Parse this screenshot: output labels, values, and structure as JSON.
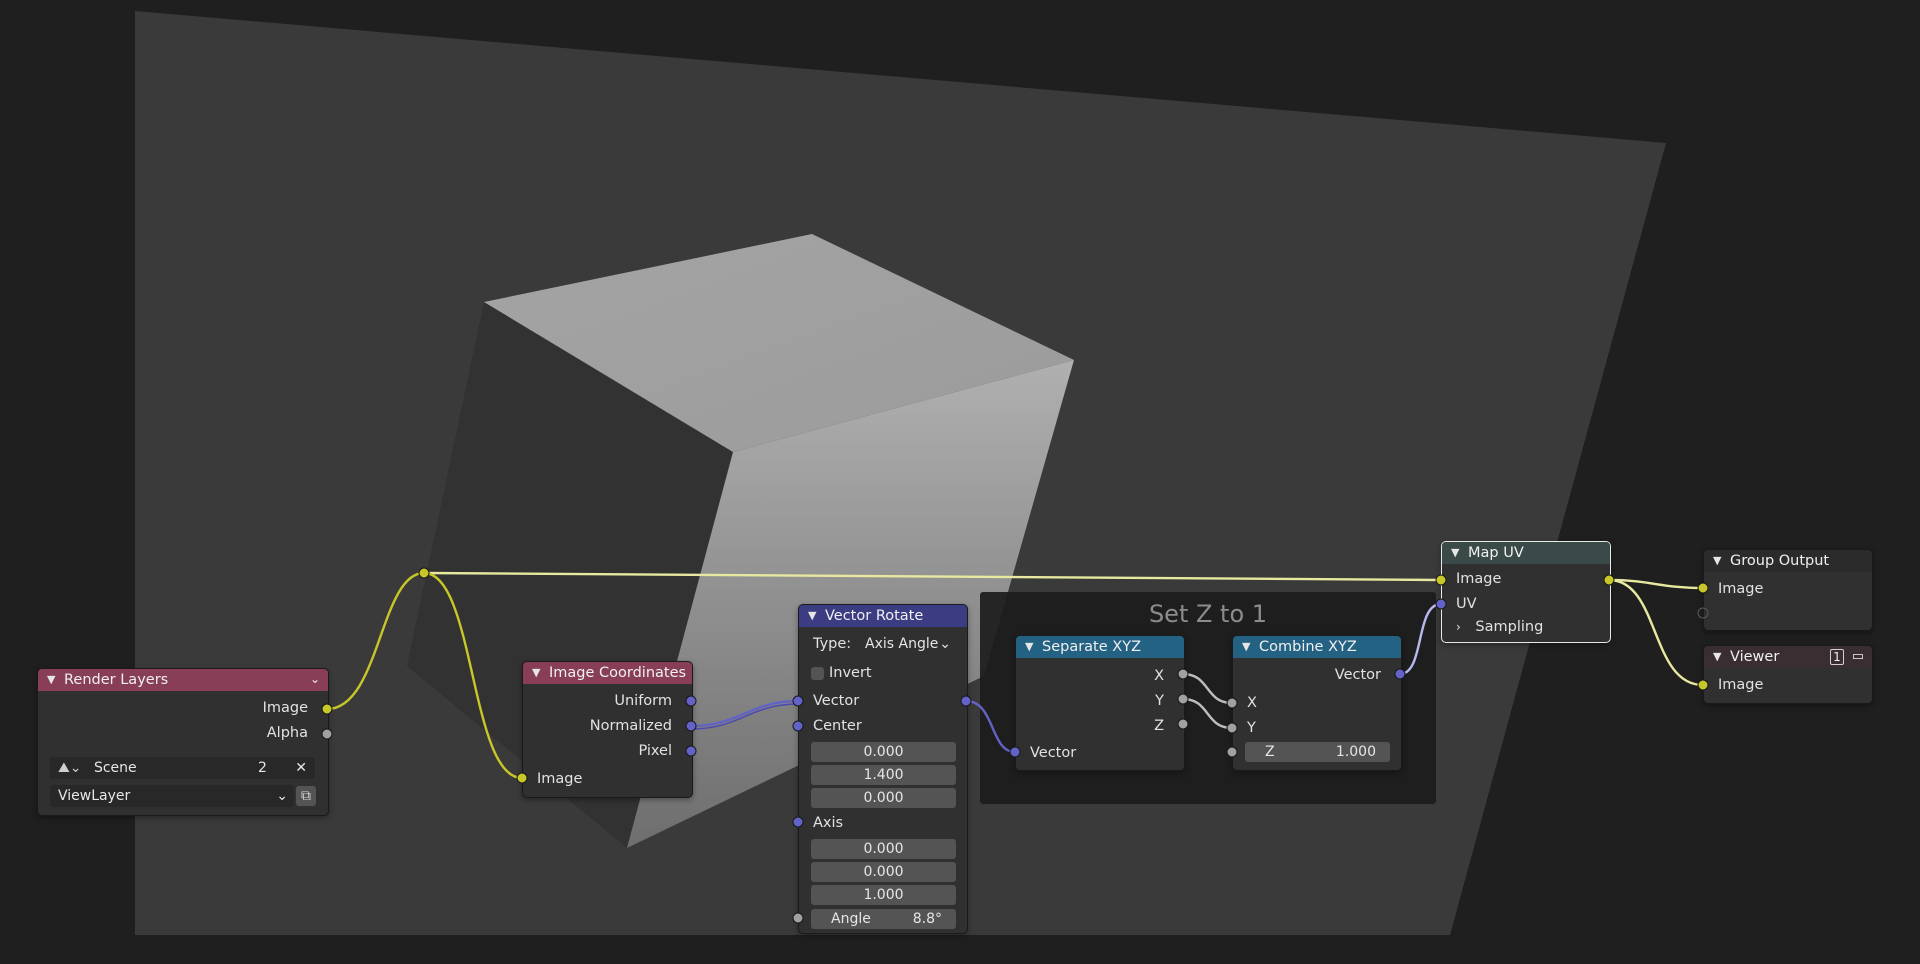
{
  "frame": {
    "label": "Set Z to 1"
  },
  "nodes": {
    "render_layers": {
      "title": "Render Layers",
      "outputs": [
        "Image",
        "Alpha"
      ],
      "scene": "Scene",
      "scene_users": "2",
      "view_layer": "ViewLayer"
    },
    "image_coordinates": {
      "title": "Image Coordinates",
      "outputs": [
        "Uniform",
        "Normalized",
        "Pixel"
      ],
      "inputs": [
        "Image"
      ]
    },
    "vector_rotate": {
      "title": "Vector Rotate",
      "type_label": "Type:",
      "type_value": "Axis Angle",
      "invert_label": "Invert",
      "inputs": [
        "Vector",
        "Center",
        "Axis",
        "Angle"
      ],
      "center": [
        "0.000",
        "1.400",
        "0.000"
      ],
      "axis": [
        "0.000",
        "0.000",
        "1.000"
      ],
      "angle": "8.8°"
    },
    "separate_xyz": {
      "title": "Separate XYZ",
      "outputs": [
        "X",
        "Y",
        "Z"
      ],
      "inputs": [
        "Vector"
      ]
    },
    "combine_xyz": {
      "title": "Combine XYZ",
      "outputs": [
        "Vector"
      ],
      "inputs": [
        "X",
        "Y"
      ],
      "z_label": "Z",
      "z_value": "1.000"
    },
    "map_uv": {
      "title": "Map UV",
      "outputs": [
        "Image"
      ],
      "inputs": [
        "Image",
        "UV"
      ],
      "panel": "Sampling"
    },
    "group_output": {
      "title": "Group Output",
      "inputs": [
        "Image"
      ]
    },
    "viewer": {
      "title": "Viewer",
      "badge": "1",
      "inputs": [
        "Image"
      ]
    }
  },
  "colors": {
    "image_socket": "#c7c729",
    "vector_socket": "#6363c7",
    "float_socket": "#a1a1a1",
    "input_header": "#873e56",
    "vector_header": "#3c3c83",
    "converter_header": "#246283",
    "distort_header": "#394a49"
  },
  "icons": [
    "chevron-down-icon",
    "render-layer-scene-icon",
    "close-icon",
    "render-icon",
    "viewer-display-icon",
    "chevron-right-icon"
  ]
}
